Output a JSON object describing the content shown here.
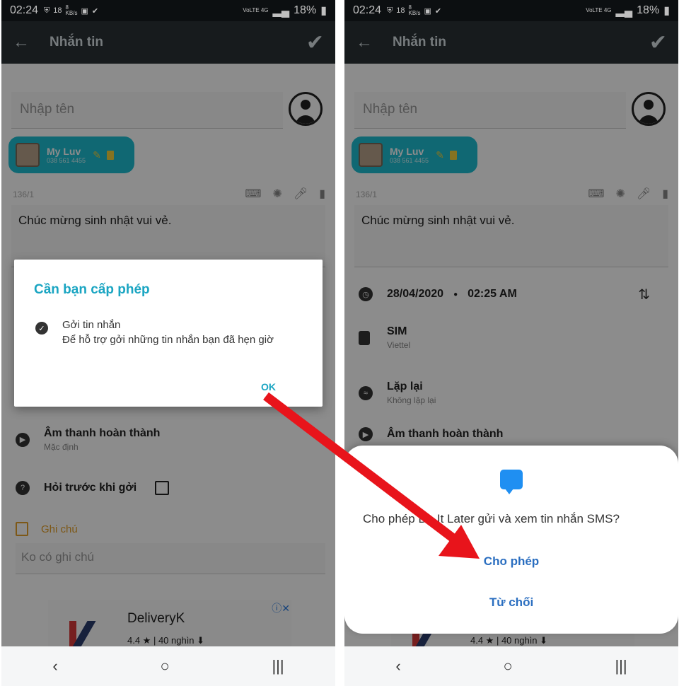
{
  "status": {
    "time": "02:24",
    "badge": "18",
    "net": "8\nKB/s",
    "signal": "VoLTE 4G",
    "battery": "18%"
  },
  "appbar": {
    "title": "Nhắn tin"
  },
  "compose": {
    "name_placeholder": "Nhập tên",
    "chip_name": "My Luv",
    "chip_number": "038 561 4455",
    "counter": "136/1",
    "message": "Chúc mừng sinh nhật vui vẻ."
  },
  "schedule": {
    "date": "28/04/2020",
    "dot": "●",
    "time": "02:25 AM",
    "sim_label": "SIM",
    "sim_value": "Viettel",
    "repeat_label": "Lặp lại",
    "repeat_value": "Không lặp lại",
    "sound_label": "Âm thanh hoàn thành",
    "sound_value": "Mặc định",
    "ask_label": "Hỏi trước khi gởi",
    "note_label": "Ghi chú",
    "note_placeholder": "Ko có ghi chú"
  },
  "ad": {
    "title": "DeliveryK",
    "stats": "4.4 ★ | 40 nghìn ⬇",
    "close": "ⓘ✕"
  },
  "dialog": {
    "title": "Cần bạn cấp phép",
    "item_title": "Gởi tin nhắn",
    "item_desc": "Để hỗ trợ gởi những tin nhắn bạn đã hẹn giờ",
    "ok": "OK"
  },
  "sheet": {
    "question": "Cho phép Do It Later gửi và xem tin nhắn SMS?",
    "allow": "Cho phép",
    "deny": "Từ chối"
  },
  "nav": {
    "back": "‹",
    "home": "○",
    "recent": "|||"
  },
  "colors": {
    "accent": "#1aa5c2",
    "chip": "#1ebed1",
    "arrow": "#e8141b",
    "sheet_button": "#2a6ec0"
  }
}
